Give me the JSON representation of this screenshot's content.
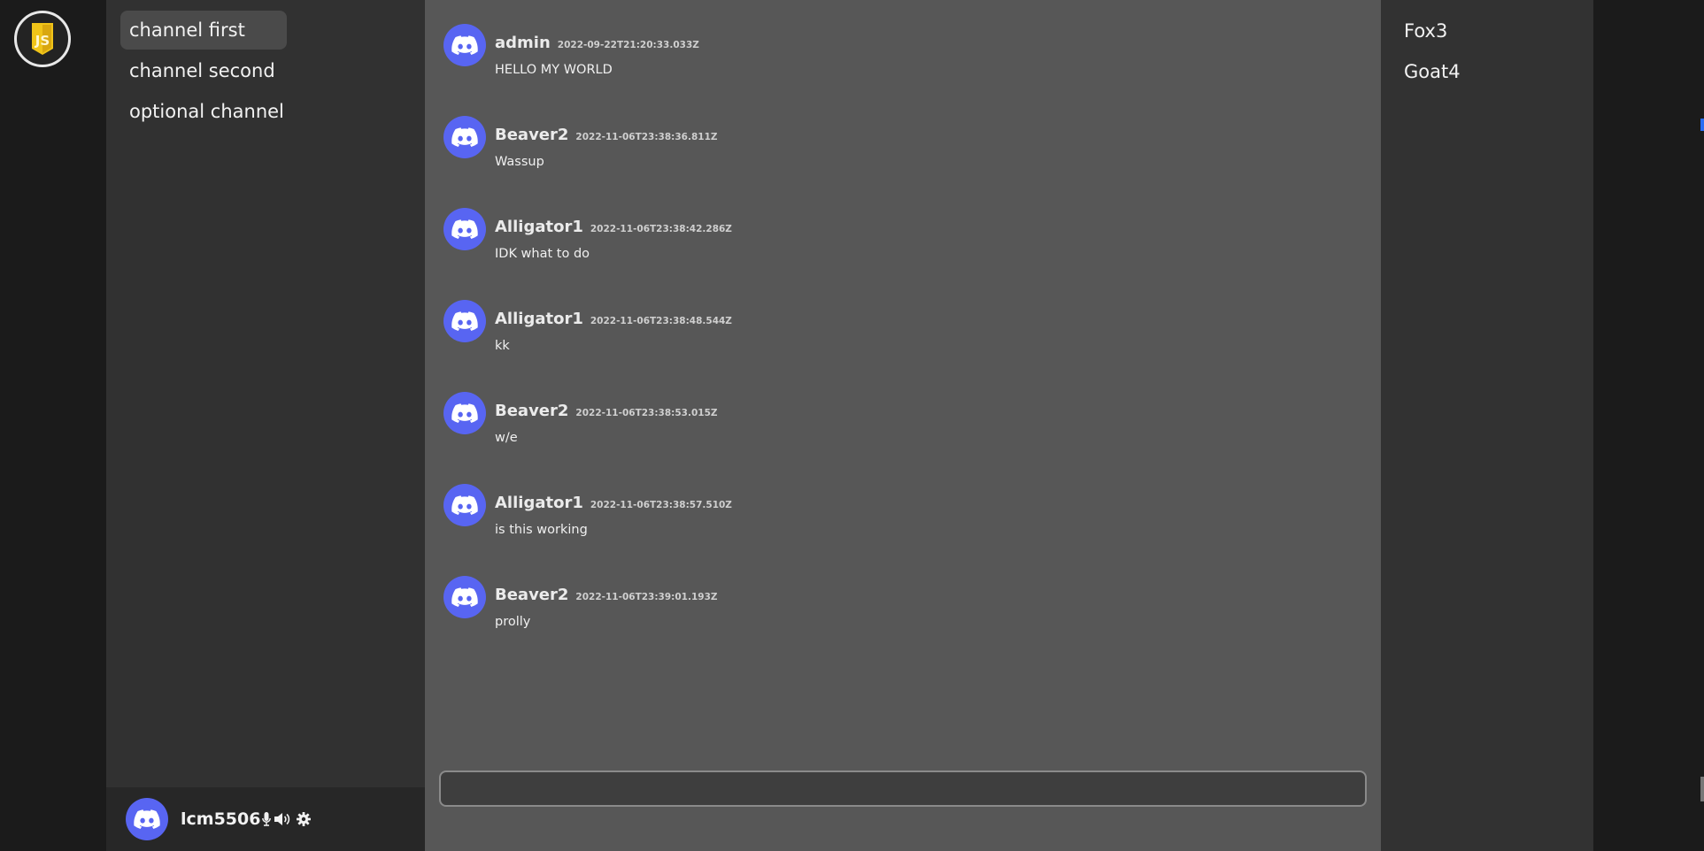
{
  "server_rail": {
    "server_icon": "js-logo-icon",
    "accent": "#f0c419"
  },
  "channels": [
    {
      "label": "channel first",
      "active": true
    },
    {
      "label": "channel second",
      "active": false
    },
    {
      "label": "optional channel",
      "active": false
    }
  ],
  "user_panel": {
    "username": "lcm5506",
    "icons": [
      "microphone-icon",
      "speaker-icon",
      "gear-icon"
    ]
  },
  "messages": [
    {
      "author": "admin",
      "time": "2022-09-22T21:20:33.033Z",
      "text": "HELLO MY WORLD"
    },
    {
      "author": "Beaver2",
      "time": "2022-11-06T23:38:36.811Z",
      "text": "Wassup"
    },
    {
      "author": "Alligator1",
      "time": "2022-11-06T23:38:42.286Z",
      "text": "IDK what to do"
    },
    {
      "author": "Alligator1",
      "time": "2022-11-06T23:38:48.544Z",
      "text": "kk"
    },
    {
      "author": "Beaver2",
      "time": "2022-11-06T23:38:53.015Z",
      "text": "w/e"
    },
    {
      "author": "Alligator1",
      "time": "2022-11-06T23:38:57.510Z",
      "text": "is this working"
    },
    {
      "author": "Beaver2",
      "time": "2022-11-06T23:39:01.193Z",
      "text": "prolly"
    }
  ],
  "composer": {
    "value": "",
    "placeholder": ""
  },
  "members": [
    "Fox3",
    "Goat4"
  ],
  "colors": {
    "avatar": "#5865f2",
    "main_bg": "#575757",
    "sidebar_bg": "#313131"
  }
}
